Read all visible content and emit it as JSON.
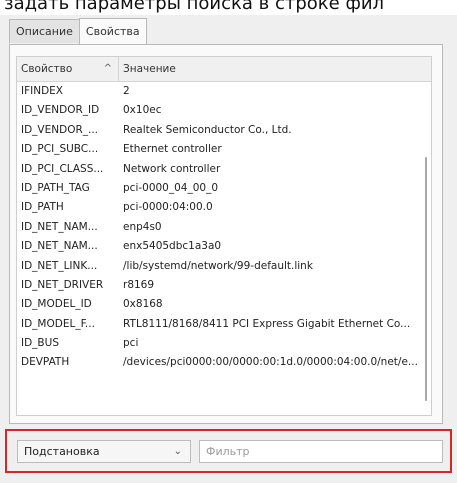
{
  "caption": "задать параметры поиска в строке фил",
  "tabs": [
    {
      "label": "Описание",
      "active": false
    },
    {
      "label": "Свойства",
      "active": true
    }
  ],
  "table": {
    "headers": {
      "property": "Свойство",
      "value": "Значение",
      "sort_icon": "chevron-up"
    },
    "rows": [
      {
        "property": "IFINDEX",
        "value": "2"
      },
      {
        "property": "ID_VENDOR_ID",
        "value": "0x10ec"
      },
      {
        "property": "ID_VENDOR_...",
        "value": "Realtek Semiconductor Co., Ltd."
      },
      {
        "property": "ID_PCI_SUBC...",
        "value": "Ethernet controller"
      },
      {
        "property": "ID_PCI_CLASS...",
        "value": "Network controller"
      },
      {
        "property": "ID_PATH_TAG",
        "value": "pci-0000_04_00_0"
      },
      {
        "property": "ID_PATH",
        "value": "pci-0000:04:00.0"
      },
      {
        "property": "ID_NET_NAM...",
        "value": "enp4s0"
      },
      {
        "property": "ID_NET_NAM...",
        "value": "enx5405dbc1a3a0"
      },
      {
        "property": "ID_NET_LINK...",
        "value": "/lib/systemd/network/99-default.link"
      },
      {
        "property": "ID_NET_DRIVER",
        "value": "r8169"
      },
      {
        "property": "ID_MODEL_ID",
        "value": "0x8168"
      },
      {
        "property": "ID_MODEL_F...",
        "value": "RTL8111/8168/8411 PCI Express Gigabit Ethernet Co..."
      },
      {
        "property": "ID_BUS",
        "value": "pci"
      },
      {
        "property": "DEVPATH",
        "value": "/devices/pci0000:00/0000:00:1d.0/0000:04:00.0/net/e..."
      }
    ]
  },
  "filter_bar": {
    "mode_selected": "Подстановка",
    "filter_placeholder": "Фильтр",
    "filter_value": "",
    "highlight_color": "#d6262a"
  }
}
